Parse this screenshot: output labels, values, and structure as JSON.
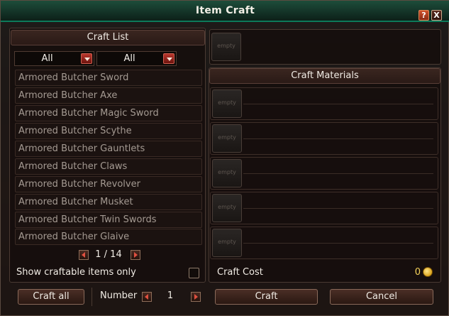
{
  "window": {
    "title": "Item Craft",
    "help_label": "?",
    "close_label": "X"
  },
  "craft_list": {
    "header": "Craft List",
    "filter1": "All",
    "filter2": "All",
    "items": [
      "Armored Butcher Sword",
      "Armored Butcher Axe",
      "Armored Butcher Magic Sword",
      "Armored Butcher Scythe",
      "Armored Butcher Gauntlets",
      "Armored Butcher Claws",
      "Armored Butcher Revolver",
      "Armored Butcher Musket",
      "Armored Butcher Twin Swords",
      "Armored Butcher Glaive"
    ],
    "pager": "1 / 14",
    "show_craftable_label": "Show craftable items only"
  },
  "result": {
    "slot_label": "empty"
  },
  "materials": {
    "header": "Craft Materials",
    "slots": [
      "empty",
      "empty",
      "empty",
      "empty",
      "empty"
    ]
  },
  "cost": {
    "label": "Craft Cost",
    "value": "0"
  },
  "footer": {
    "craft_all_label": "Craft all",
    "number_label": "Number",
    "number_value": "1",
    "craft_label": "Craft",
    "cancel_label": "Cancel"
  },
  "colors": {
    "accent": "#0c7a5a",
    "gold": "#f5d25a",
    "button_red": "#b8362c"
  },
  "icons": [
    "help-icon",
    "close-icon",
    "dropdown-arrow-icon",
    "prev-arrow-icon",
    "next-arrow-icon",
    "gold-coin-icon"
  ]
}
